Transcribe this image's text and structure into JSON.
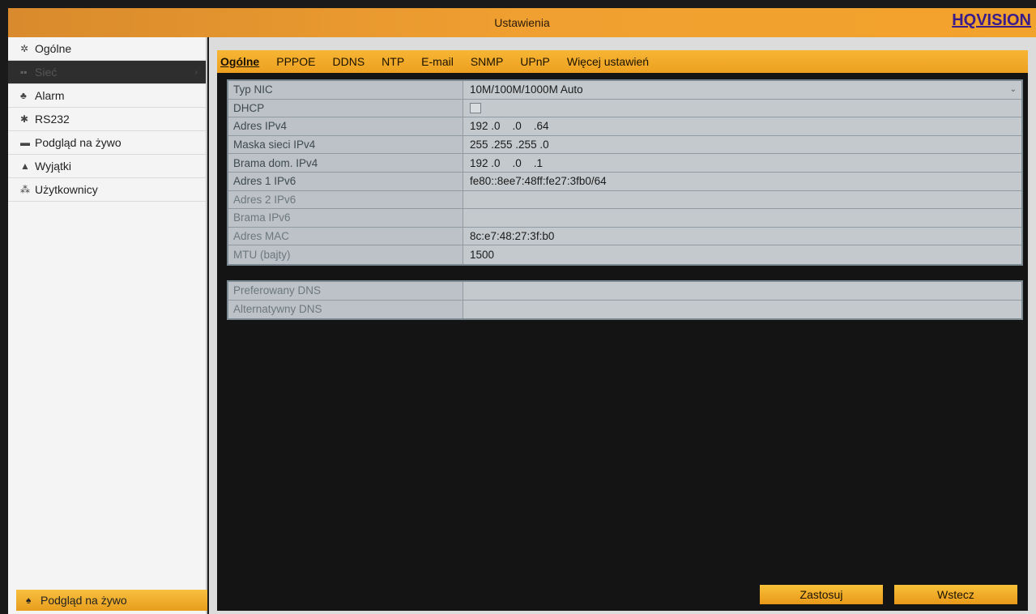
{
  "window": {
    "title": "Ustawienia",
    "logo_text": "HQVISION"
  },
  "sidebar": {
    "items": [
      {
        "label": "Ogólne",
        "icon": "gear-icon"
      },
      {
        "label": "Sieć",
        "icon": "network-icon",
        "active": true
      },
      {
        "label": "Alarm",
        "icon": "alarm-icon"
      },
      {
        "label": "RS232",
        "icon": "rs232-icon"
      },
      {
        "label": "Podgląd na żywo",
        "icon": "live-view-icon"
      },
      {
        "label": "Wyjątki",
        "icon": "warning-icon"
      },
      {
        "label": "Użytkownicy",
        "icon": "users-icon"
      }
    ],
    "bottom_button": {
      "label": "Podgląd na żywo",
      "icon": "home-icon"
    }
  },
  "tabs": [
    {
      "label": "Ogólne",
      "active": true
    },
    {
      "label": "PPPOE"
    },
    {
      "label": "DDNS"
    },
    {
      "label": "NTP"
    },
    {
      "label": "E-mail"
    },
    {
      "label": "SNMP"
    },
    {
      "label": "UPnP"
    },
    {
      "label": "Więcej ustawień"
    }
  ],
  "form": {
    "rows": [
      {
        "label": "Typ NIC",
        "value": "10M/100M/1000M Auto",
        "type": "select"
      },
      {
        "label": "DHCP",
        "value": "",
        "type": "checkbox",
        "checked": false
      },
      {
        "label": "Adres IPv4",
        "value": "192 .0    .0    .64"
      },
      {
        "label": "Maska sieci IPv4",
        "value": "255 .255 .255 .0"
      },
      {
        "label": "Brama dom. IPv4",
        "value": "192 .0    .0    .1"
      },
      {
        "label": "Adres 1 IPv6",
        "value": "fe80::8ee7:48ff:fe27:3fb0/64"
      },
      {
        "label": "Adres 2 IPv6",
        "value": ""
      },
      {
        "label": "Brama IPv6",
        "value": ""
      },
      {
        "label": "Adres MAC",
        "value": "8c:e7:48:27:3f:b0"
      },
      {
        "label": "MTU (bajty)",
        "value": "1500"
      }
    ],
    "dns_rows": [
      {
        "label": "Preferowany DNS",
        "value": ""
      },
      {
        "label": "Alternatywny DNS",
        "value": ""
      }
    ]
  },
  "buttons": {
    "apply": "Zastosuj",
    "back": "Wstecz"
  },
  "colors": {
    "accent": "#f0a030",
    "sidebar_active": "#2e2e2e",
    "content_bg": "#141414"
  }
}
